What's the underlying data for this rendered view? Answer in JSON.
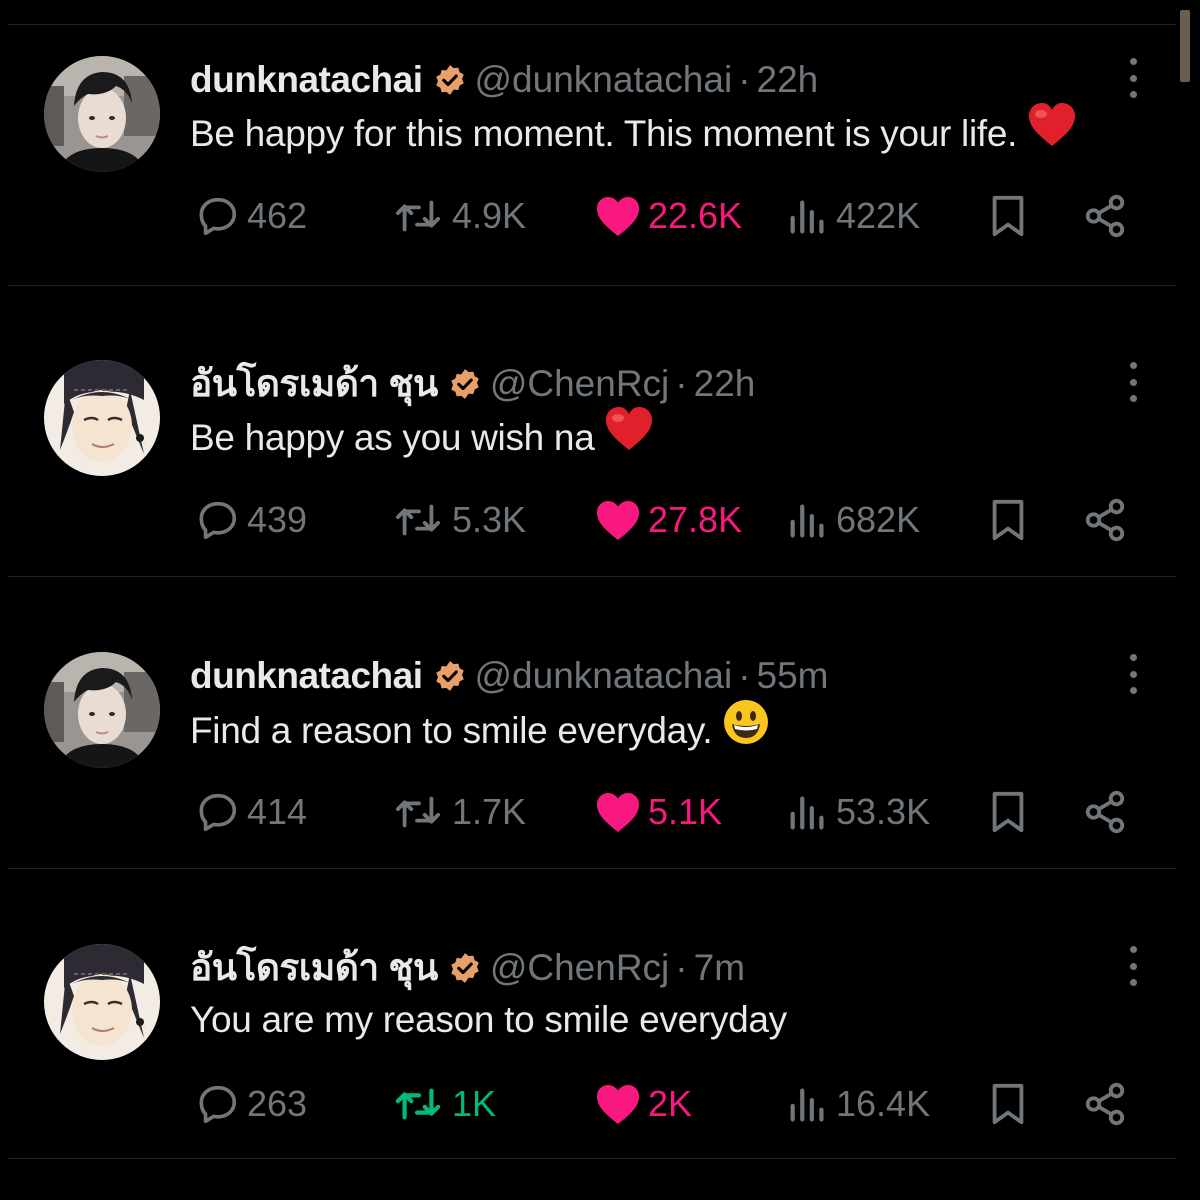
{
  "tweets": [
    {
      "display_name": "dunknatachai",
      "handle": "@dunknatachai",
      "separator": "·",
      "time": "22h",
      "text": "Be happy for this moment. This moment is your life.",
      "emoji": "red-heart",
      "avatar": "photo-avatar",
      "retweet_active": false,
      "stats": {
        "replies": "462",
        "retweets": "4.9K",
        "likes": "22.6K",
        "views": "422K"
      }
    },
    {
      "display_name": "อันโดรเมด้า ชุน",
      "handle": "@ChenRcj",
      "separator": "·",
      "time": "22h",
      "text": "Be happy as you wish na",
      "emoji": "red-heart",
      "avatar": "anime-avatar",
      "retweet_active": false,
      "stats": {
        "replies": "439",
        "retweets": "5.3K",
        "likes": "27.8K",
        "views": "682K"
      }
    },
    {
      "display_name": "dunknatachai",
      "handle": "@dunknatachai",
      "separator": "·",
      "time": "55m",
      "text": "Find a reason to smile everyday.",
      "emoji": "grinning-face",
      "avatar": "photo-avatar",
      "retweet_active": false,
      "stats": {
        "replies": "414",
        "retweets": "1.7K",
        "likes": "5.1K",
        "views": "53.3K"
      }
    },
    {
      "display_name": "อันโดรเมด้า ชุน",
      "handle": "@ChenRcj",
      "separator": "·",
      "time": "7m",
      "text": "You are my reason to smile everyday",
      "emoji": "",
      "avatar": "anime-avatar",
      "retweet_active": true,
      "stats": {
        "replies": "263",
        "retweets": "1K",
        "likes": "2K",
        "views": "16.4K"
      }
    }
  ],
  "colors": {
    "background": "#000000",
    "primary_text": "#e7e9ea",
    "secondary_text": "#71767b",
    "like": "#f91880",
    "retweet_active": "#00ba7c",
    "verified_badge": "#e8a06b",
    "divider": "#1f2123"
  }
}
